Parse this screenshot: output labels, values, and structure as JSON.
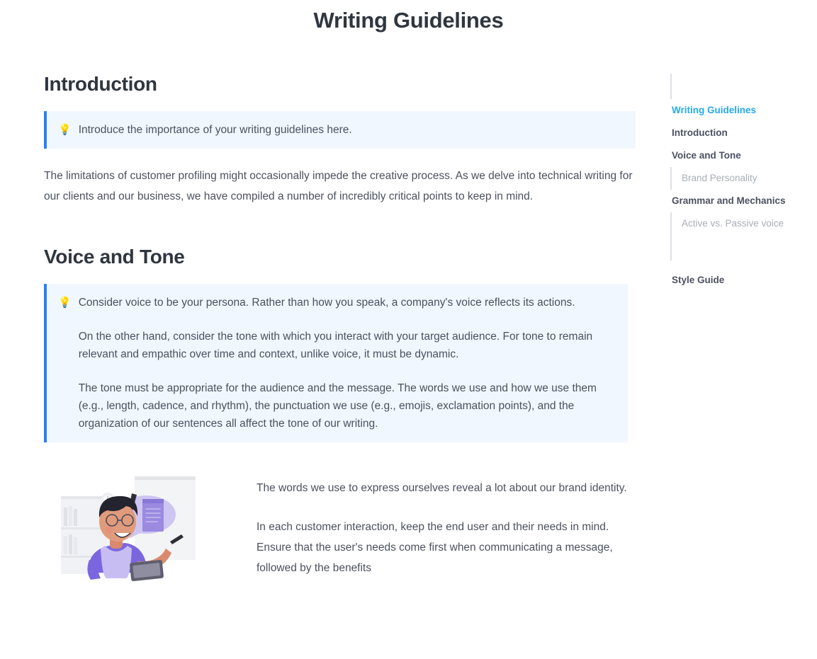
{
  "document": {
    "title": "Writing Guidelines"
  },
  "sections": {
    "introduction": {
      "heading": "Introduction",
      "callout": {
        "icon": "lightbulb-icon",
        "icon_glyph": "💡",
        "paragraphs": [
          "Introduce the importance of your writing guidelines here."
        ]
      },
      "paragraph": "The limitations of customer profiling might occasionally impede the creative process. As we delve into technical writing for our clients and our business, we have compiled a number of incredibly critical points to keep in mind."
    },
    "voice_and_tone": {
      "heading": "Voice and Tone",
      "callout": {
        "icon": "lightbulb-icon",
        "icon_glyph": "💡",
        "paragraphs": [
          "Consider voice to be your persona. Rather than how you speak, a company's voice reflects its actions.",
          "On the other hand, consider the tone with which you interact with your target audience. For tone to remain relevant and empathic over time and context, unlike voice, it must be dynamic.",
          "The tone must be appropriate for the audience and the message. The words we use and how we use them (e.g., length, cadence, and rhythm), the punctuation we use (e.g., emojis, exclamation points), and the organization of our sentences all affect the tone of our writing."
        ]
      },
      "media": {
        "illustration_name": "person-presenting-illustration",
        "paragraphs": [
          "The words we use to express ourselves reveal a lot about our brand identity.",
          "In each customer interaction, keep the end user and their needs in mind. Ensure that the user's needs come first when communicating a message, followed by the benefits"
        ]
      }
    }
  },
  "outline": {
    "items": [
      {
        "label": "Writing Guidelines",
        "level": 1,
        "active": true
      },
      {
        "label": "Introduction",
        "level": 1,
        "active": false
      },
      {
        "label": "Voice and Tone",
        "level": 1,
        "active": false
      },
      {
        "label": "Brand Personality",
        "level": 2,
        "active": false
      },
      {
        "label": "Grammar and Mechanics",
        "level": 1,
        "active": false
      },
      {
        "label": "Active vs. Passive voice",
        "level": 2,
        "active": false
      },
      {
        "label": "Style Guide",
        "level": 1,
        "active": false
      }
    ]
  },
  "colors": {
    "accent_blue": "#2b7ff5",
    "active_outline": "#25a9ef",
    "callout_bg": "#f1f7fe",
    "heading": "#2f3640",
    "body_text": "#4a5160",
    "muted_text": "#a7adb7",
    "rail": "#dcdfe4"
  }
}
